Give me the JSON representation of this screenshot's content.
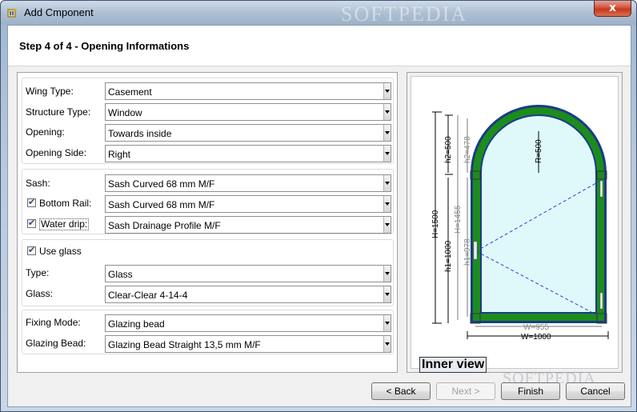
{
  "window": {
    "title": "Add Cmponent",
    "watermark": "SOFTPEDIA",
    "close_label": "x"
  },
  "header": {
    "step_title": "Step 4 of 4 - Opening Informations"
  },
  "groups": {
    "wing": {
      "wing_type": {
        "label": "Wing Type:",
        "value": "Casement"
      },
      "structure_type": {
        "label": "Structure Type:",
        "value": "Window"
      },
      "opening": {
        "label": "Opening:",
        "value": "Towards inside"
      },
      "opening_side": {
        "label": "Opening Side:",
        "value": "Right"
      }
    },
    "sash": {
      "sash": {
        "label": "Sash:",
        "value": "Sash Curved 68 mm M/F"
      },
      "bottom_rail": {
        "label": "Bottom Rail:",
        "value": "Sash Curved 68 mm M/F",
        "checked": true
      },
      "water_drip": {
        "label": "Water drip:",
        "value": "Sash Drainage Profile M/F",
        "checked": true
      }
    },
    "glass": {
      "use_glass": {
        "label": "Use glass",
        "checked": true
      },
      "type": {
        "label": "Type:",
        "value": "Glass"
      },
      "glass": {
        "label": "Glass:",
        "value": "Clear-Clear 4-14-4"
      }
    },
    "fixing": {
      "fixing_mode": {
        "label": "Fixing Mode:",
        "value": "Glazing bead"
      },
      "glazing_bead": {
        "label": "Glazing Bead:",
        "value": "Glazing Bead Straight 13,5 mm M/F"
      }
    }
  },
  "drawing": {
    "inner_view_label": "Inner view",
    "dims": {
      "H": "H=1500",
      "h1": "h1=1000",
      "h2": "h2=500",
      "H_inner": "H=1455",
      "h2_inner": "h2=478",
      "h1_inner": "h1=978",
      "R": "R=500",
      "W": "W=1000",
      "W_inner": "W=955"
    },
    "colors": {
      "frame_outer": "#1a3b87",
      "frame_green": "#1c8c1c",
      "glass": "#dff9fb",
      "opening_line": "#2a3fd8"
    }
  },
  "footer": {
    "back": "< Back",
    "next": "Next >",
    "finish": "Finish",
    "cancel": "Cancel",
    "watermark": "SOFTPEDIA"
  }
}
